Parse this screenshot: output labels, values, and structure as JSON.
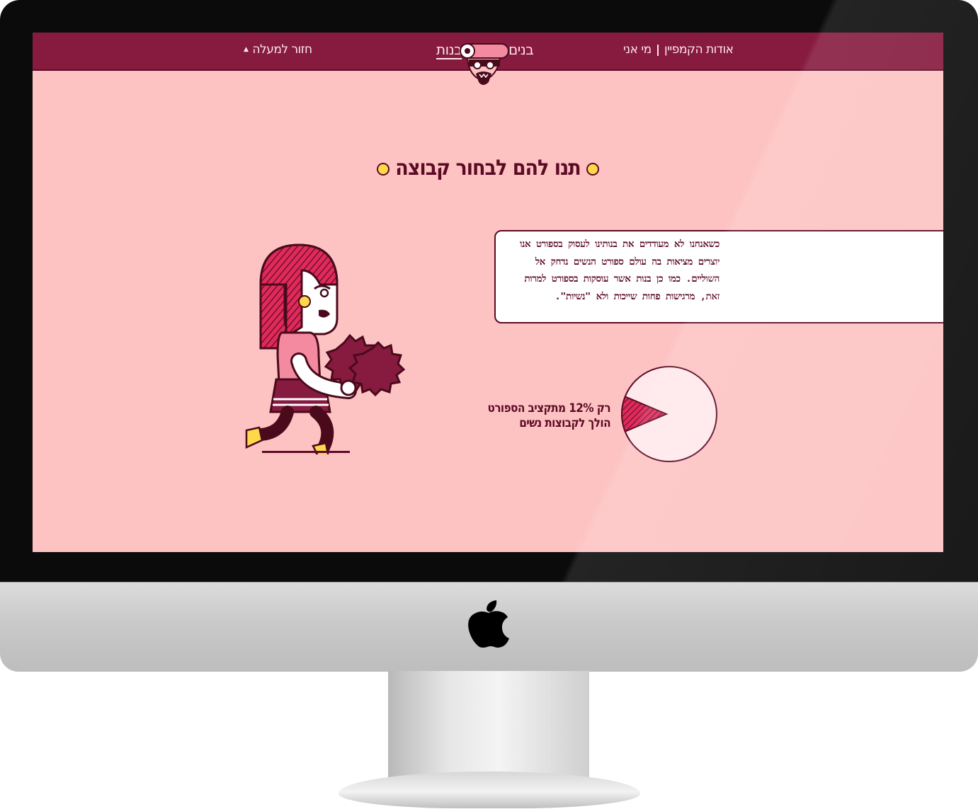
{
  "nav": {
    "about_campaign": "אודות הקמפיין",
    "who_am_i": "מי אני",
    "boys": "בנים",
    "girls": "בנות",
    "back_to_top": "חזור למעלה",
    "back_arrow": "▲"
  },
  "section": {
    "title": "תנו להם לבחור קבוצה",
    "paragraph": "כשאנחנו לא מעודדים את בנותינו לעסוק בספורט אנו יוצרים מציאות בה עולם ספורט הנשים נדחק אל השוליים. כמו כן בנות אשר עוסקות בספורט למרות זאת, מרגישות פחות שייכות ולא \"נשיות\".",
    "stat_line1": "רק 12% מתקציב הספורט",
    "stat_line2": "הולך לקבוצות נשים"
  },
  "chart_data": {
    "type": "pie",
    "slices": [
      {
        "label": "קבוצות נשים",
        "value": 12,
        "color": "#e02a5a"
      },
      {
        "label": "",
        "value": 88,
        "color": "#ffe9ec"
      }
    ]
  },
  "colors": {
    "nav_bg": "#861a3f",
    "screen_bg": "#fdc3c3",
    "text_dark": "#5c0b25",
    "accent_yellow": "#ffd84a",
    "accent_pink": "#e02a5a"
  },
  "icons": {
    "brand": "mascot-logo-icon",
    "device": "apple-logo-icon"
  }
}
